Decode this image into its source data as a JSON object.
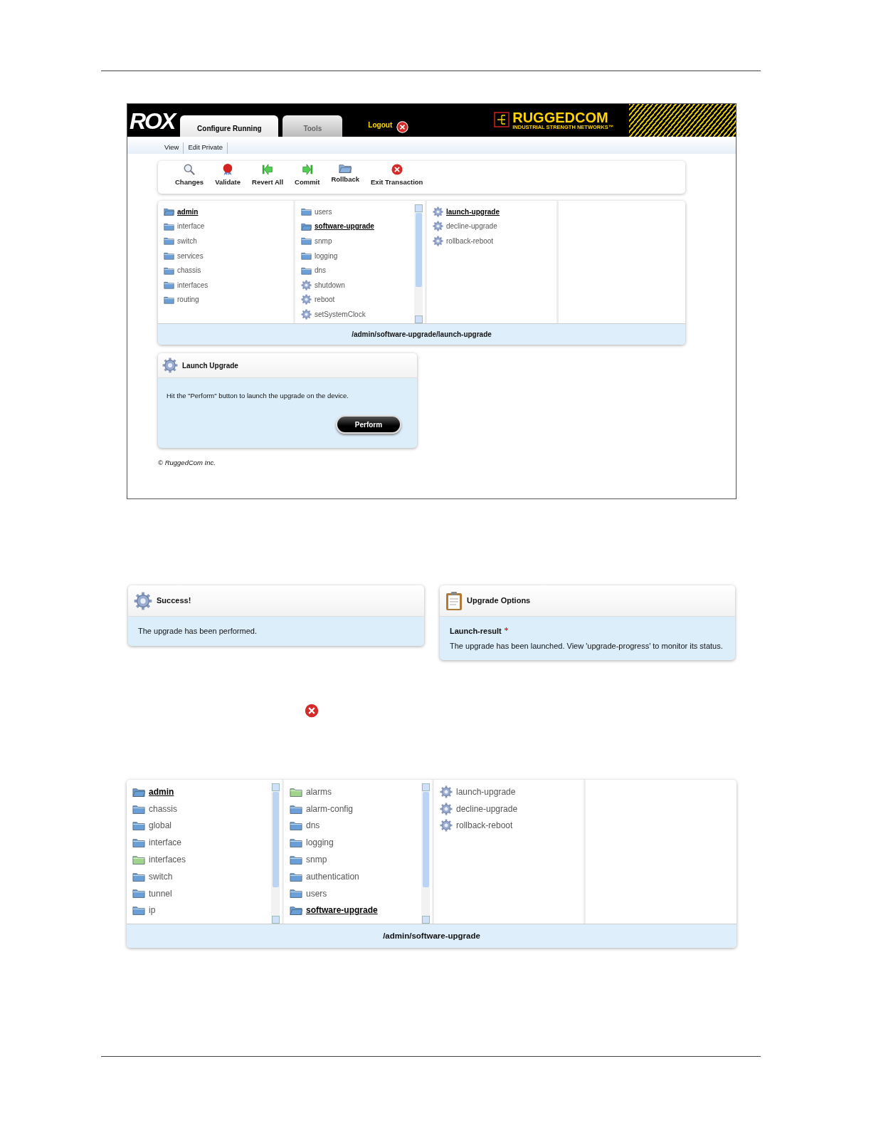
{
  "app_screen": {
    "logo": "ROX",
    "tabs": [
      {
        "label": "Configure Running",
        "selected": true
      },
      {
        "label": "Tools",
        "selected": false
      }
    ],
    "logout": "Logout",
    "brand": "RUGGEDCOM",
    "brand_tagline": "INDUSTRIAL STRENGTH NETWORKS™",
    "subnav": [
      "View",
      "Edit Private"
    ],
    "toolbar": [
      {
        "label": "Changes",
        "kind": "search"
      },
      {
        "label": "Validate",
        "kind": "validate"
      },
      {
        "label": "Revert All",
        "kind": "revert"
      },
      {
        "label": "Commit",
        "kind": "commit"
      },
      {
        "label": "Rollback",
        "kind": "rollback"
      },
      {
        "label": "Exit Transaction",
        "kind": "exit"
      }
    ],
    "browser": {
      "columns": [
        {
          "scrollbar": false,
          "items": [
            {
              "label": "admin",
              "kind": "folder",
              "selected": true
            },
            {
              "label": "interface",
              "kind": "folder",
              "selected": false
            },
            {
              "label": "switch",
              "kind": "folder",
              "selected": false
            },
            {
              "label": "services",
              "kind": "folder",
              "selected": false
            },
            {
              "label": "chassis",
              "kind": "folder",
              "selected": false
            },
            {
              "label": "interfaces",
              "kind": "folder",
              "selected": false
            },
            {
              "label": "routing",
              "kind": "folder",
              "selected": false
            }
          ]
        },
        {
          "scrollbar": true,
          "items": [
            {
              "label": "users",
              "kind": "folder",
              "selected": false
            },
            {
              "label": "software-upgrade",
              "kind": "folder",
              "selected": true
            },
            {
              "label": "snmp",
              "kind": "folder",
              "selected": false
            },
            {
              "label": "logging",
              "kind": "folder",
              "selected": false
            },
            {
              "label": "dns",
              "kind": "folder",
              "selected": false
            },
            {
              "label": "shutdown",
              "kind": "action",
              "selected": false
            },
            {
              "label": "reboot",
              "kind": "action",
              "selected": false
            },
            {
              "label": "setSystemClock",
              "kind": "action",
              "selected": false
            }
          ]
        },
        {
          "scrollbar": false,
          "items": [
            {
              "label": "launch-upgrade",
              "kind": "action",
              "selected": true
            },
            {
              "label": "decline-upgrade",
              "kind": "action",
              "selected": false
            },
            {
              "label": "rollback-reboot",
              "kind": "action",
              "selected": false
            }
          ]
        },
        {
          "scrollbar": false
        }
      ],
      "path": "/admin/software-upgrade/launch-upgrade"
    },
    "panel": {
      "title": "Launch Upgrade",
      "text": "Hit the \"Perform\" button to launch the upgrade on the device.",
      "button": "Perform"
    },
    "copyright": "© RuggedCom Inc."
  },
  "result_screen": {
    "success": {
      "title": "Success!",
      "text": "The upgrade has been performed."
    },
    "options": {
      "title": "Upgrade Options",
      "field_label": "Launch-result",
      "required": true,
      "text": "The upgrade has been launched. View 'upgrade-progress' to monitor its status."
    }
  },
  "browser_screen": {
    "columns": [
      {
        "scrollbar": true,
        "items": [
          {
            "label": "admin",
            "kind": "folder",
            "selected": true,
            "color": "#6a9fd8"
          },
          {
            "label": "chassis",
            "kind": "folder",
            "selected": false,
            "color": "#6a9fd8"
          },
          {
            "label": "global",
            "kind": "folder",
            "selected": false,
            "color": "#6a9fd8"
          },
          {
            "label": "interface",
            "kind": "folder",
            "selected": false,
            "color": "#6a9fd8"
          },
          {
            "label": "interfaces",
            "kind": "folder",
            "selected": false,
            "color": "#9fd48a"
          },
          {
            "label": "switch",
            "kind": "folder",
            "selected": false,
            "color": "#6a9fd8"
          },
          {
            "label": "tunnel",
            "kind": "folder",
            "selected": false,
            "color": "#6a9fd8"
          },
          {
            "label": "ip",
            "kind": "folder",
            "selected": false,
            "color": "#6a9fd8"
          }
        ]
      },
      {
        "scrollbar": true,
        "items": [
          {
            "label": "alarms",
            "kind": "folder",
            "selected": false,
            "color": "#9fd48a"
          },
          {
            "label": "alarm-config",
            "kind": "folder",
            "selected": false,
            "color": "#6a9fd8"
          },
          {
            "label": "dns",
            "kind": "folder",
            "selected": false,
            "color": "#6a9fd8"
          },
          {
            "label": "logging",
            "kind": "folder",
            "selected": false,
            "color": "#6a9fd8"
          },
          {
            "label": "snmp",
            "kind": "folder",
            "selected": false,
            "color": "#6a9fd8"
          },
          {
            "label": "authentication",
            "kind": "folder",
            "selected": false,
            "color": "#6a9fd8"
          },
          {
            "label": "users",
            "kind": "folder",
            "selected": false,
            "color": "#6a9fd8"
          },
          {
            "label": "software-upgrade",
            "kind": "folder",
            "selected": true,
            "color": "#6a9fd8"
          }
        ]
      },
      {
        "scrollbar": false,
        "items": [
          {
            "label": "launch-upgrade",
            "kind": "action",
            "selected": false
          },
          {
            "label": "decline-upgrade",
            "kind": "action",
            "selected": false
          },
          {
            "label": "rollback-reboot",
            "kind": "action",
            "selected": false
          }
        ]
      },
      {
        "scrollbar": false
      }
    ],
    "path": "/admin/software-upgrade"
  }
}
